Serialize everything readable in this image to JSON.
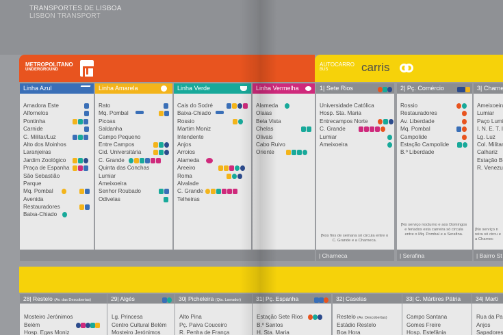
{
  "header": {
    "title_pt": "TRANSPORTES DE LISBOA",
    "title_en": "LISBON TRANSPORT"
  },
  "metro": {
    "label": "METROPOLITANO",
    "sublabel": "UNDERGROUND",
    "logo_text": "metro"
  },
  "carris": {
    "label": "AUTOCARRO",
    "sublabel": "BUS",
    "brand": "carris"
  },
  "colors": {
    "metro": "#e8541f",
    "carris": "#f6d20a",
    "azul": "#3a6fb7",
    "amarela": "#f3b41b",
    "verde": "#18a99a",
    "vermelha": "#cf2a7c",
    "bus_grey": "#8b8d91"
  },
  "lines": [
    {
      "name": "Linha Azul",
      "color": "#3a6fb7",
      "icon": "plane-icon",
      "stations": [
        "Amadora Este",
        "Alfornelos",
        "Pontinha",
        "Carnide",
        "C. Militar/Luz",
        "Alto dos Moinhos",
        "Laranjeiras",
        "Jardim Zoológico",
        "Praça de Espanha",
        "São Sebastião",
        "Parque",
        "Mq. Pombal",
        "Avenida",
        "Restauradores",
        "Baixa-Chiado"
      ]
    },
    {
      "name": "Linha Amarela",
      "color": "#f3b41b",
      "icon": "flower-icon",
      "stations": [
        "Rato",
        "Mq. Pombal",
        "Picoas",
        "Saldanha",
        "Campo Pequeno",
        "Entre Campos",
        "Cid. Universitária",
        "C. Grande",
        "Quinta das Conchas",
        "Lumiar",
        "Ameixoeira",
        "Senhor Roubado",
        "Odivelas"
      ]
    },
    {
      "name": "Linha Verde",
      "color": "#18a99a",
      "icon": "boat-icon",
      "stations": [
        "Cais do Sodré",
        "Baixa-Chiado",
        "Rossio",
        "Martim Moniz",
        "Intendente",
        "Anjos",
        "Arroios",
        "Alameda",
        "Areeiro",
        "Roma",
        "Alvalade",
        "C. Grande",
        "Telheiras"
      ]
    },
    {
      "name": "Linha Vermelha",
      "color": "#cf2a7c",
      "icon": "seahorse-icon",
      "stations": [
        "Alameda",
        "Olaias",
        "Bela Vista",
        "Chelas",
        "Olivais",
        "Cabo Ruivo",
        "Oriente"
      ]
    }
  ],
  "bus_routes": [
    {
      "name": "1| Sete Rios",
      "stops": [
        "Universidade Católica",
        "Hosp. Sta. Maria",
        "Entrecampos Norte",
        "C. Grande",
        "Lumiar",
        "Ameixoeira"
      ],
      "note": "[Nos fins de semana só circula entre o C. Grande e a Charneca.",
      "footer": "| Charneca"
    },
    {
      "name": "2| Pç. Comércio",
      "stops": [
        "Rossio",
        "Restauradores",
        "Av. Liberdade",
        "Mq. Pombal",
        "Campolide",
        "Estação Campolide",
        "B.º Liberdade"
      ],
      "note": "[No serviço nocturno e aos Domingos e feriados esta carreira só circula entre o Mq. Pombal e a Serafina.",
      "footer": "| Serafina"
    },
    {
      "name": "3| Charne",
      "stops": [
        "Ameixoeira",
        "Lumiar",
        "Paço Lumia",
        "I. N. E. T. I.",
        "Lg. Luz",
        "Col. Militar",
        "Calhariz",
        "Estação Be",
        "R. Venezue"
      ],
      "note": "[No serviço n reira só circu e a Charnec",
      "footer": "| Bairro St"
    }
  ],
  "bottom_routes": [
    {
      "name": "28| Restelo",
      "sub": "(Av. das Descobertas)",
      "stops": [
        "Mosteiro Jerónimos",
        "Belém",
        "Hosp. Egas Moniz"
      ]
    },
    {
      "name": "29| Algés",
      "sub": "",
      "stops": [
        "Lg. Princesa",
        "Centro Cultural Belém",
        "Mosteiro Jerónimos"
      ]
    },
    {
      "name": "30| Picheleira",
      "sub": "(Qta. Lavrador)",
      "stops": [
        "Alto Pina",
        "Pç. Paiva Couceiro",
        "R. Penha de França"
      ]
    },
    {
      "name": "31| Pç. Espanha",
      "sub": "",
      "stops": [
        "Estação Sete Rios",
        "B.º Santos",
        "H. Sta. Maria"
      ]
    },
    {
      "name": "32| Caselas",
      "sub": "",
      "stops": [
        "Restelo",
        "Estádio Restelo",
        "Boa Hora"
      ],
      "stop_subs": [
        "(Av. Descobertas)",
        "",
        ""
      ]
    },
    {
      "name": "33| C. Mártires Pátria",
      "sub": "",
      "stops": [
        "Campo Santana",
        "Gomes Freire",
        "Hosp. Estefânia"
      ]
    },
    {
      "name": "34| Marti",
      "sub": "",
      "stops": [
        "Rua da Pal",
        "Anjos",
        "Sapadores"
      ]
    }
  ]
}
